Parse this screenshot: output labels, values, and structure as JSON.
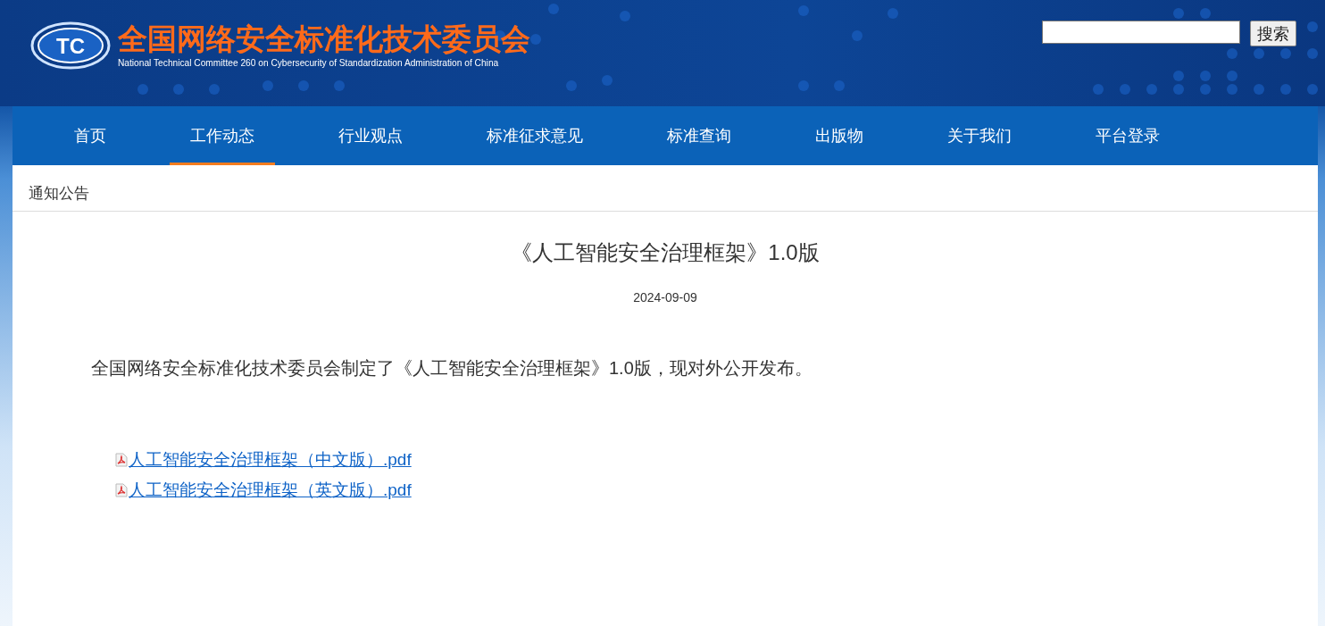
{
  "header": {
    "logo_mark": "TC",
    "title": "全国网络安全标准化技术委员会",
    "subtitle": "National Technical Committee 260 on Cybersecurity of Standardization Administration of China",
    "search": {
      "button": "搜索"
    }
  },
  "nav": [
    {
      "label": "首页",
      "selected": false
    },
    {
      "label": "工作动态",
      "selected": true
    },
    {
      "label": "行业观点",
      "selected": false
    },
    {
      "label": "标准征求意见",
      "selected": false
    },
    {
      "label": "标准查询",
      "selected": false
    },
    {
      "label": "出版物",
      "selected": false
    },
    {
      "label": "关于我们",
      "selected": false
    },
    {
      "label": "平台登录",
      "selected": false
    }
  ],
  "breadcrumb": "通知公告",
  "article": {
    "title": "《人工智能安全治理框架》1.0版",
    "date": "2024-09-09",
    "body": "全国网络安全标准化技术委员会制定了《人工智能安全治理框架》1.0版，现对外公开发布。",
    "attachments": [
      {
        "label": "人工智能安全治理框架（中文版）.pdf"
      },
      {
        "label": "人工智能安全治理框架（英文版）.pdf"
      }
    ]
  }
}
